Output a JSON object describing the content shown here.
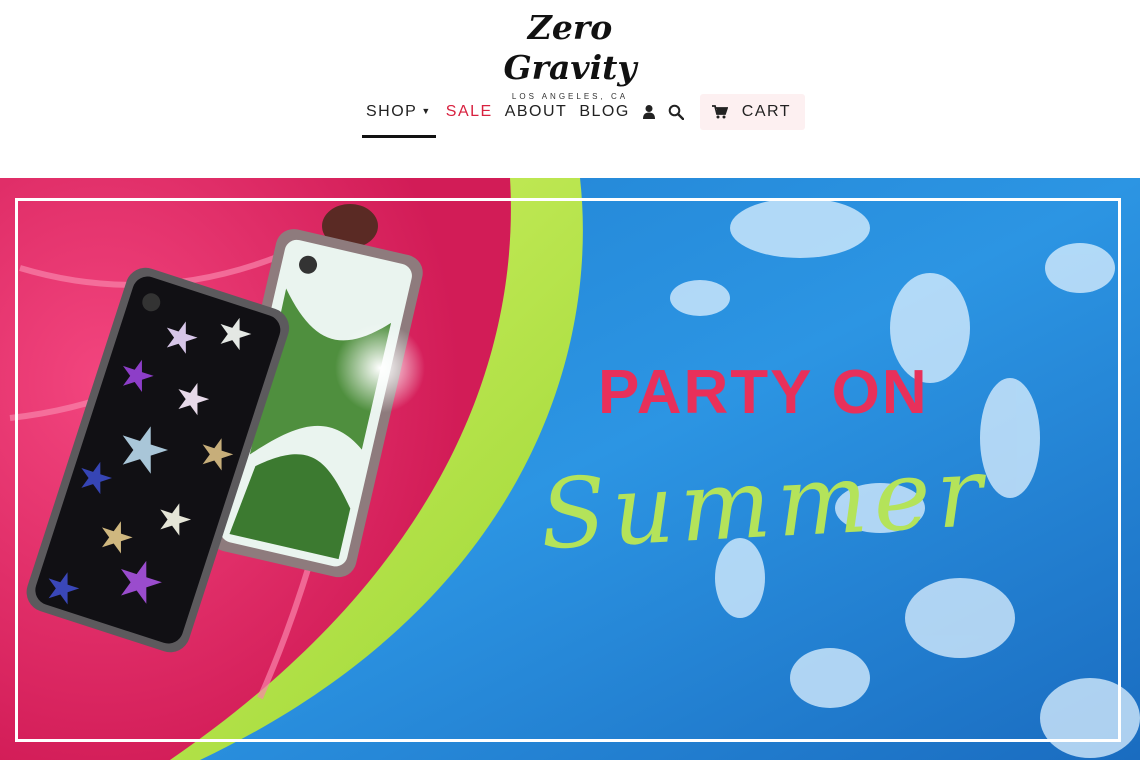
{
  "brand": {
    "name": "Zero Gravity",
    "location": "LOS ANGELES, CA"
  },
  "nav": {
    "shop": "SHOP",
    "sale": "SALE",
    "about": "ABOUT",
    "blog": "BLOG",
    "account_icon": "user-icon",
    "search_icon": "search-icon",
    "cart_icon": "cart-icon",
    "cart": "CART",
    "sale_color": "#d8213f"
  },
  "hero": {
    "headline": "PARTY ON",
    "subline": "Summer",
    "headline_color": "#e8305a",
    "subline_color": "#b4e35a"
  }
}
